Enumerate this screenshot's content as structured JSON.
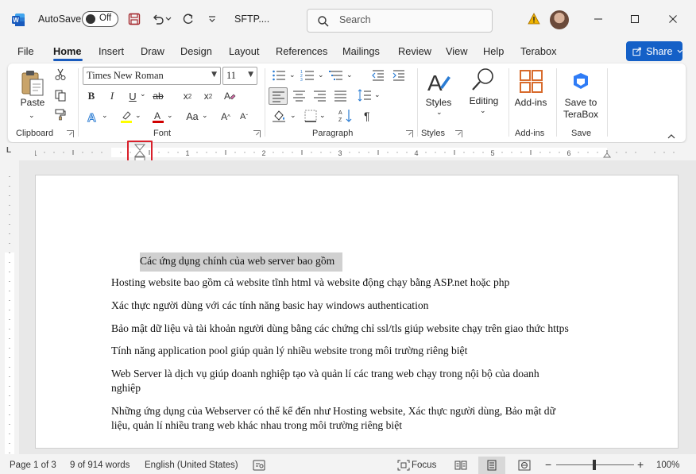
{
  "titlebar": {
    "autosave_label": "AutoSave",
    "autosave_state": "Off",
    "doc_title": "SFTP....",
    "search_placeholder": "Search"
  },
  "tabs": [
    "File",
    "Home",
    "Insert",
    "Draw",
    "Design",
    "Layout",
    "References",
    "Mailings",
    "Review",
    "View",
    "Help",
    "Terabox"
  ],
  "active_tab": "Home",
  "share_label": "Share",
  "ribbon": {
    "clipboard": {
      "paste_label": "Paste",
      "group_label": "Clipboard"
    },
    "font": {
      "name": "Times New Roman",
      "size": "11",
      "group_label": "Font"
    },
    "paragraph": {
      "group_label": "Paragraph"
    },
    "styles": {
      "label": "Styles",
      "group_label": "Styles"
    },
    "editing": {
      "label": "Editing"
    },
    "addins": {
      "label": "Add-ins",
      "group_label": "Add-ins"
    },
    "save": {
      "label_line1": "Save to",
      "label_line2": "TeraBox",
      "group_label": "Save"
    }
  },
  "ruler_numbers": [
    "1",
    "1",
    "2",
    "3",
    "4",
    "5",
    "6"
  ],
  "document": {
    "heading": "Các ứng dụng chính của web server bao gồm",
    "paragraphs": [
      "Hosting website bao gồm cả website tĩnh html và website động chạy bằng ASP.net hoặc php",
      "Xác thực người dùng với các tính năng basic hay windows authentication",
      "Bảo mật dữ liệu và tài khoản người dùng bằng các chứng chỉ ssl/tls giúp website chạy trên giao thức https",
      "Tính năng application pool giúp quản lý nhiều website trong môi trường riêng biệt",
      "Web Server là dịch vụ giúp doanh nghiệp tạo và quản lí các trang web chạy trong nội bộ của doanh",
      "nghiệp",
      "Những ứng dụng của Webserver có thể kể đến như Hosting website, Xác thực người dùng, Bảo mật dữ",
      "liệu, quản lí nhiều trang web khác nhau trong môi trường riêng biệt"
    ]
  },
  "statusbar": {
    "page": "Page 1 of 3",
    "words": "9 of 914 words",
    "language": "English (United States)",
    "focus": "Focus",
    "zoom": "100%"
  },
  "colors": {
    "accent": "#185abd",
    "share_bg": "#1460c7",
    "highlight_box": "#d9202b",
    "selection": "#d0d0d0"
  }
}
